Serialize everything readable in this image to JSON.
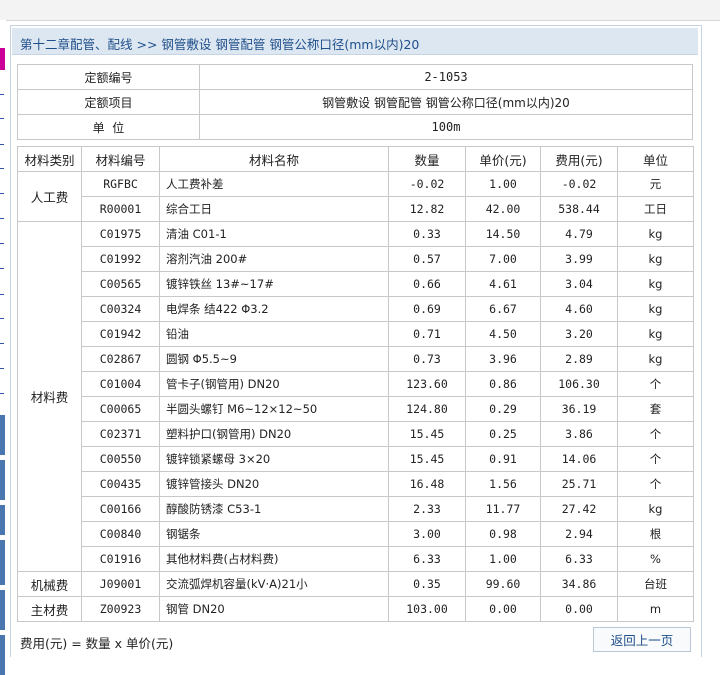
{
  "breadcrumb": "第十二章配管、配线 >> 钢管敷设 钢管配管 钢管公称口径(mm以内)20",
  "quota": {
    "code_label": "定额编号",
    "code": "2-1053",
    "item_label": "定额项目",
    "item": "钢管敷设 钢管配管 钢管公称口径(mm以内)20",
    "unit_label": "单  位",
    "unit": "100m"
  },
  "headers": [
    "材料类别",
    "材料编号",
    "材料名称",
    "数量",
    "单价(元)",
    "费用(元)",
    "单位"
  ],
  "groups": [
    {
      "category": "人工费",
      "rows": [
        [
          "RGFBC",
          "人工费补差",
          "-0.02",
          "1.00",
          "-0.02",
          "元"
        ],
        [
          "R00001",
          "综合工日",
          "12.82",
          "42.00",
          "538.44",
          "工日"
        ]
      ]
    },
    {
      "category": "材料费",
      "rows": [
        [
          "C01975",
          "清油 C01-1",
          "0.33",
          "14.50",
          "4.79",
          "kg"
        ],
        [
          "C01992",
          "溶剂汽油 200#",
          "0.57",
          "7.00",
          "3.99",
          "kg"
        ],
        [
          "C00565",
          "镀锌铁丝 13#~17#",
          "0.66",
          "4.61",
          "3.04",
          "kg"
        ],
        [
          "C00324",
          "电焊条 结422 Φ3.2",
          "0.69",
          "6.67",
          "4.60",
          "kg"
        ],
        [
          "C01942",
          "铅油",
          "0.71",
          "4.50",
          "3.20",
          "kg"
        ],
        [
          "C02867",
          "圆钢 Φ5.5~9",
          "0.73",
          "3.96",
          "2.89",
          "kg"
        ],
        [
          "C01004",
          "管卡子(钢管用) DN20",
          "123.60",
          "0.86",
          "106.30",
          "个"
        ],
        [
          "C00065",
          "半圆头螺钉 M6~12×12~50",
          "124.80",
          "0.29",
          "36.19",
          "套"
        ],
        [
          "C02371",
          "塑料护口(钢管用) DN20",
          "15.45",
          "0.25",
          "3.86",
          "个"
        ],
        [
          "C00550",
          "镀锌锁紧螺母 3×20",
          "15.45",
          "0.91",
          "14.06",
          "个"
        ],
        [
          "C00435",
          "镀锌管接头 DN20",
          "16.48",
          "1.56",
          "25.71",
          "个"
        ],
        [
          "C00166",
          "醇酸防锈漆 C53-1",
          "2.33",
          "11.77",
          "27.42",
          "kg"
        ],
        [
          "C00840",
          "钢锯条",
          "3.00",
          "0.98",
          "2.94",
          "根"
        ],
        [
          "C01916",
          "其他材料费(占材料费)",
          "6.33",
          "1.00",
          "6.33",
          "%"
        ]
      ]
    },
    {
      "category": "机械费",
      "rows": [
        [
          "J09001",
          "交流弧焊机容量(kV·A)21小",
          "0.35",
          "99.60",
          "34.86",
          "台班"
        ]
      ]
    },
    {
      "category": "主材费",
      "rows": [
        [
          "Z00923",
          "钢管 DN20",
          "103.00",
          "0.00",
          "0.00",
          "m"
        ]
      ]
    }
  ],
  "footer": {
    "formula": "费用(元) = 数量 x 单价(元)",
    "back_label": "返回上一页"
  }
}
